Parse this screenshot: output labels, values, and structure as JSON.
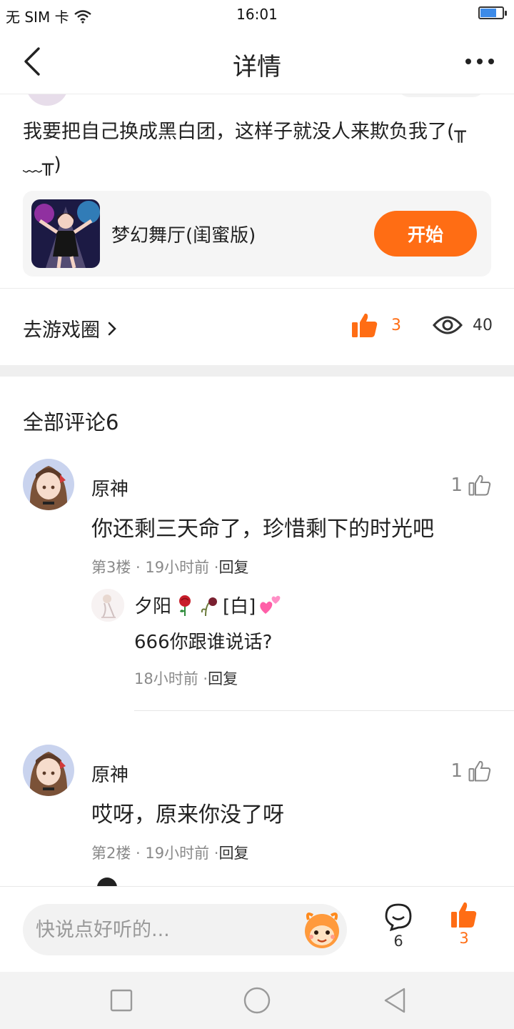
{
  "status_bar": {
    "carrier": "无 SIM 卡",
    "time": "16:01"
  },
  "header": {
    "title": "详情"
  },
  "post": {
    "text_line1": "我要把自己换成黑白团，这样子就没人来欺负我了(╥",
    "text_line2": "﹏╥)"
  },
  "game": {
    "name": "梦幻舞厅(闺蜜版)",
    "button": "开始"
  },
  "stats": {
    "circle_link": "去游戏圈",
    "likes": "3",
    "views": "40"
  },
  "comments": {
    "title": "全部评论6",
    "items": [
      {
        "name": "原神",
        "likes": "1",
        "text": "你还剩三天命了，珍惜剩下的时光吧",
        "meta": "第3楼 · 19小时前 ·",
        "reply_label": "回复",
        "reply": {
          "name": "夕阳",
          "name_suffix": "[白]",
          "text": "666你跟谁说话?",
          "meta": "18小时前 ·",
          "reply_label": "回复"
        }
      },
      {
        "name": "原神",
        "likes": "1",
        "text": "哎呀，原来你没了呀",
        "meta": "第2楼 · 19小时前 ·",
        "reply_label": "回复"
      }
    ]
  },
  "bottom_bar": {
    "input_placeholder": "快说点好听的...",
    "comment_count": "6",
    "like_count": "3"
  },
  "colors": {
    "accent": "#ff6d14",
    "battery": "#3d8be8",
    "band": "#efefef"
  },
  "icons": [
    "wifi-icon",
    "battery-icon",
    "back-arrow-icon",
    "more-dots-icon",
    "thumbs-up-icon",
    "eye-icon",
    "chevron-right-icon",
    "comment-bubble-icon",
    "mascot-icon",
    "rose-icon",
    "wilted-rose-icon",
    "hearts-icon"
  ]
}
